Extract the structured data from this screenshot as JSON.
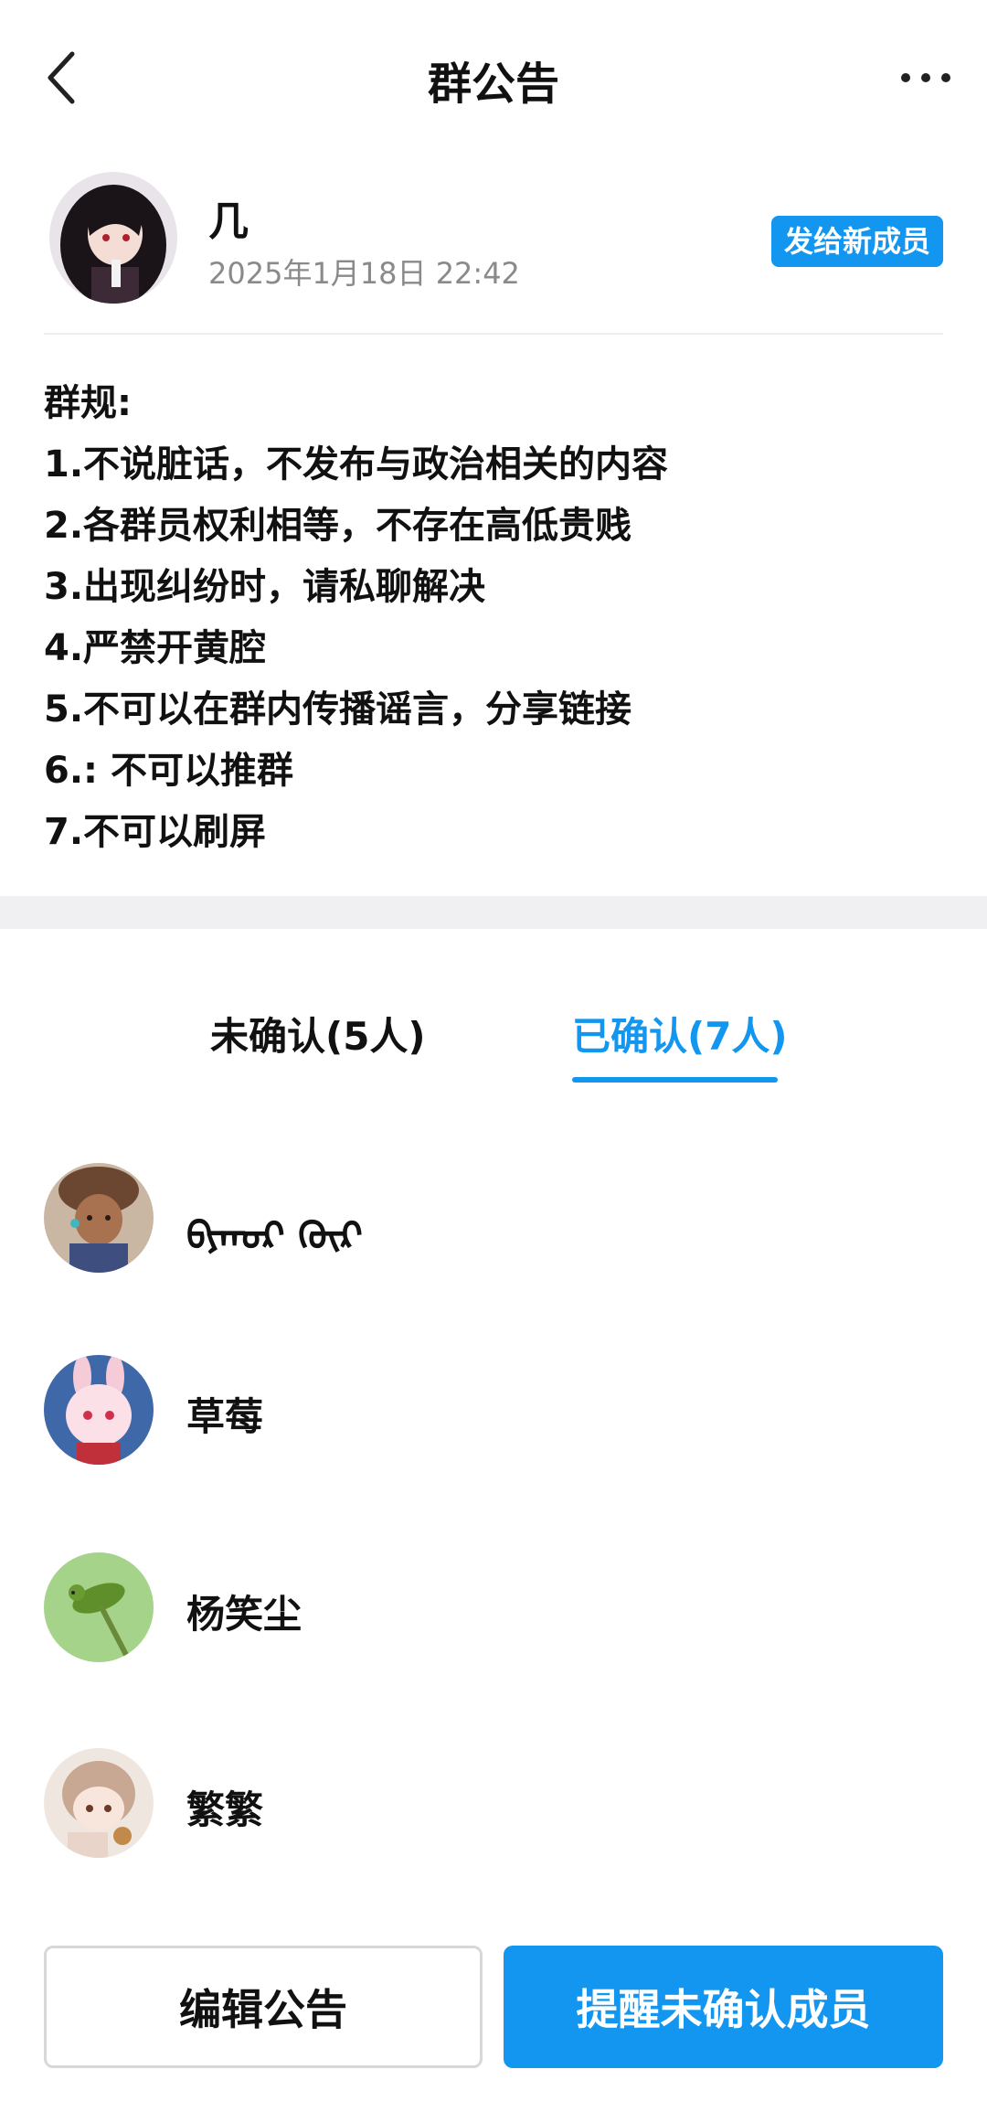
{
  "colors": {
    "accent": "#1296f0",
    "band": "#f0f0f2"
  },
  "header": {
    "title": "群公告",
    "back_icon": "chevron-left-icon",
    "more_icon": "more-horizontal-icon"
  },
  "author": {
    "name": "几",
    "time": "2025年1月18日 22:42",
    "send_new_label": "发给新成员"
  },
  "announcement": {
    "lines": [
      "群规:",
      "1.不说脏话，不发布与政治相关的内容",
      "2.各群员权利相等，不存在高低贵贱",
      "3.出现纠纷时，请私聊解决",
      "4.严禁开黄腔",
      "5.不可以在群内传播谣言，分享链接",
      "6.:  不可以推群",
      "7.不可以刷屏"
    ]
  },
  "tabs": {
    "unconfirmed": "未确认(5人)",
    "confirmed": "已确认(7人)",
    "active": "confirmed"
  },
  "members": [
    {
      "name": "ᡋᠶᠬᠣᠷ ᠬᠦᠷ"
    },
    {
      "name": "草莓"
    },
    {
      "name": "杨笑尘"
    },
    {
      "name": "繁繁"
    }
  ],
  "actions": {
    "edit_label": "编辑公告",
    "remind_label": "提醒未确认成员"
  }
}
